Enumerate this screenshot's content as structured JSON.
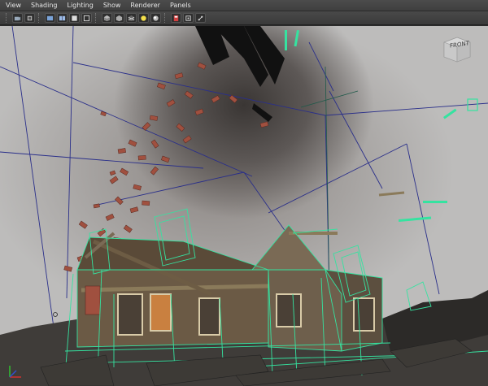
{
  "menu": [
    "View",
    "Shading",
    "Lighting",
    "Show",
    "Renderer",
    "Panels"
  ],
  "toolbar": {
    "buttons": [
      "camera-icon",
      "bookmark-icon",
      "grid-icon",
      "grid-icon",
      "image-plane-icon",
      "fit-icon",
      "wireframe-icon",
      "smooth-shade-icon",
      "textured-icon",
      "lights-icon",
      "shadows-icon",
      "isolate-icon",
      "xray-icon",
      "xray-joints-icon"
    ]
  },
  "viewcube": {
    "label": "FRONT"
  },
  "colors": {
    "wire_green": "#35e3a0",
    "wire_blue": "#2a2f8a",
    "brick": "#a0503f",
    "wood": "#6b5a45"
  }
}
